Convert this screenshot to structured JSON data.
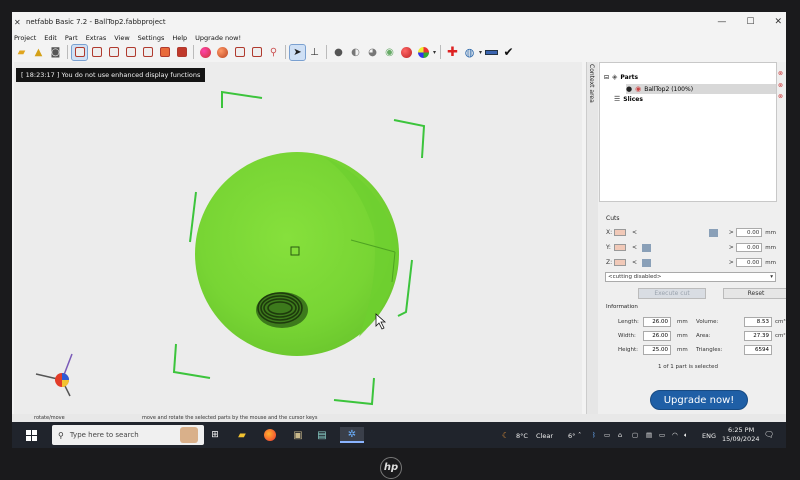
{
  "window": {
    "title": "netfabb Basic 7.2 - BallTop2.fabbproject",
    "icons": [
      "app-logo-icon",
      "minimize-icon",
      "maximize-icon",
      "close-icon"
    ]
  },
  "menu": {
    "items": [
      "Project",
      "Edit",
      "Part",
      "Extras",
      "View",
      "Settings",
      "Help",
      "Upgrade now!"
    ]
  },
  "viewport": {
    "message": "[ 18:23:17 ] You do not use enhanced display functions",
    "model_color": "#7edc3a"
  },
  "status": {
    "left": "rotate/move",
    "right": "move and rotate the selected parts by the mouse and the cursor keys"
  },
  "side_tab": {
    "label": "Context area"
  },
  "tree": {
    "parts_label": "Parts",
    "part_item": "BallTop2 (100%)",
    "slices_label": "Slices"
  },
  "cuts": {
    "heading": "Cuts",
    "rows": [
      {
        "axis": "X:",
        "value": "0.00",
        "unit": "mm"
      },
      {
        "axis": "Y:",
        "value": "0.00",
        "unit": "mm"
      },
      {
        "axis": "Z:",
        "value": "0.00",
        "unit": "mm"
      }
    ],
    "mode": "<cutting disabled>",
    "execute_label": "Execute cut",
    "reset_label": "Reset"
  },
  "information": {
    "heading": "Information",
    "length_label": "Length:",
    "length": "26.00",
    "length_unit": "mm",
    "width_label": "Width:",
    "width": "26.00",
    "width_unit": "mm",
    "height_label": "Height:",
    "height": "25.00",
    "height_unit": "mm",
    "volume_label": "Volume:",
    "volume": "8.53",
    "volume_unit": "cm³",
    "area_label": "Area:",
    "area": "27.39",
    "area_unit": "cm²",
    "triangles_label": "Triangles:",
    "triangles": "6594",
    "selected": "1 of 1 part is selected"
  },
  "upgrade_label": "Upgrade now!",
  "taskbar": {
    "search_placeholder": "Type here to search",
    "weather_temp": "8°C",
    "weather_text": "Clear",
    "temp_small": "6°",
    "language": "ENG",
    "time": "6:25 PM",
    "date": "15/09/2024"
  },
  "brand": "hp"
}
